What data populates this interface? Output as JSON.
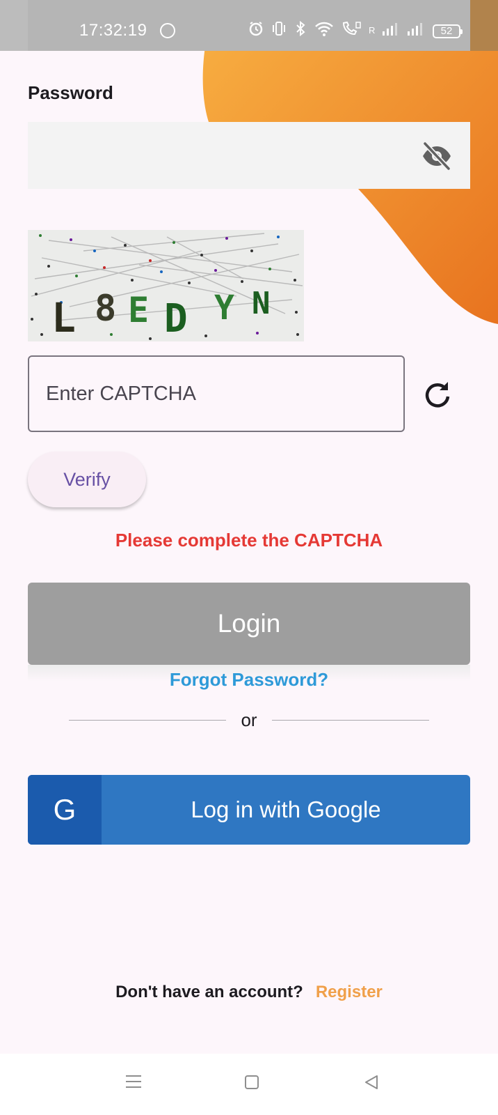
{
  "status_bar": {
    "time": "17:32:19",
    "battery": "52",
    "icons": [
      "whatsapp-icon",
      "alarm-icon",
      "vibrate-icon",
      "bluetooth-icon",
      "wifi-icon",
      "call-icon",
      "signal-icon",
      "battery-icon"
    ],
    "signal_label": "R"
  },
  "form": {
    "password_label": "Password",
    "password_value": "",
    "visibility_icon": "eye-off-icon",
    "captcha_text": "L8EDYN",
    "captcha_placeholder": "Enter CAPTCHA",
    "refresh_icon": "refresh-icon",
    "verify_label": "Verify",
    "error_message": "Please complete the CAPTCHA",
    "login_label": "Login",
    "forgot_label": "Forgot Password?",
    "or_label": "or",
    "google_letter": "G",
    "google_label": "Log in with Google",
    "no_account_label": "Don't have an account?",
    "register_label": "Register"
  },
  "nav_bar": {
    "items": [
      "menu-icon",
      "home-icon",
      "back-icon"
    ]
  },
  "colors": {
    "accent_orange": "#f0a04a",
    "error_red": "#e53935",
    "link_blue": "#2e9ad8",
    "google_blue": "#2f77c2",
    "verify_purple": "#6750a4"
  }
}
